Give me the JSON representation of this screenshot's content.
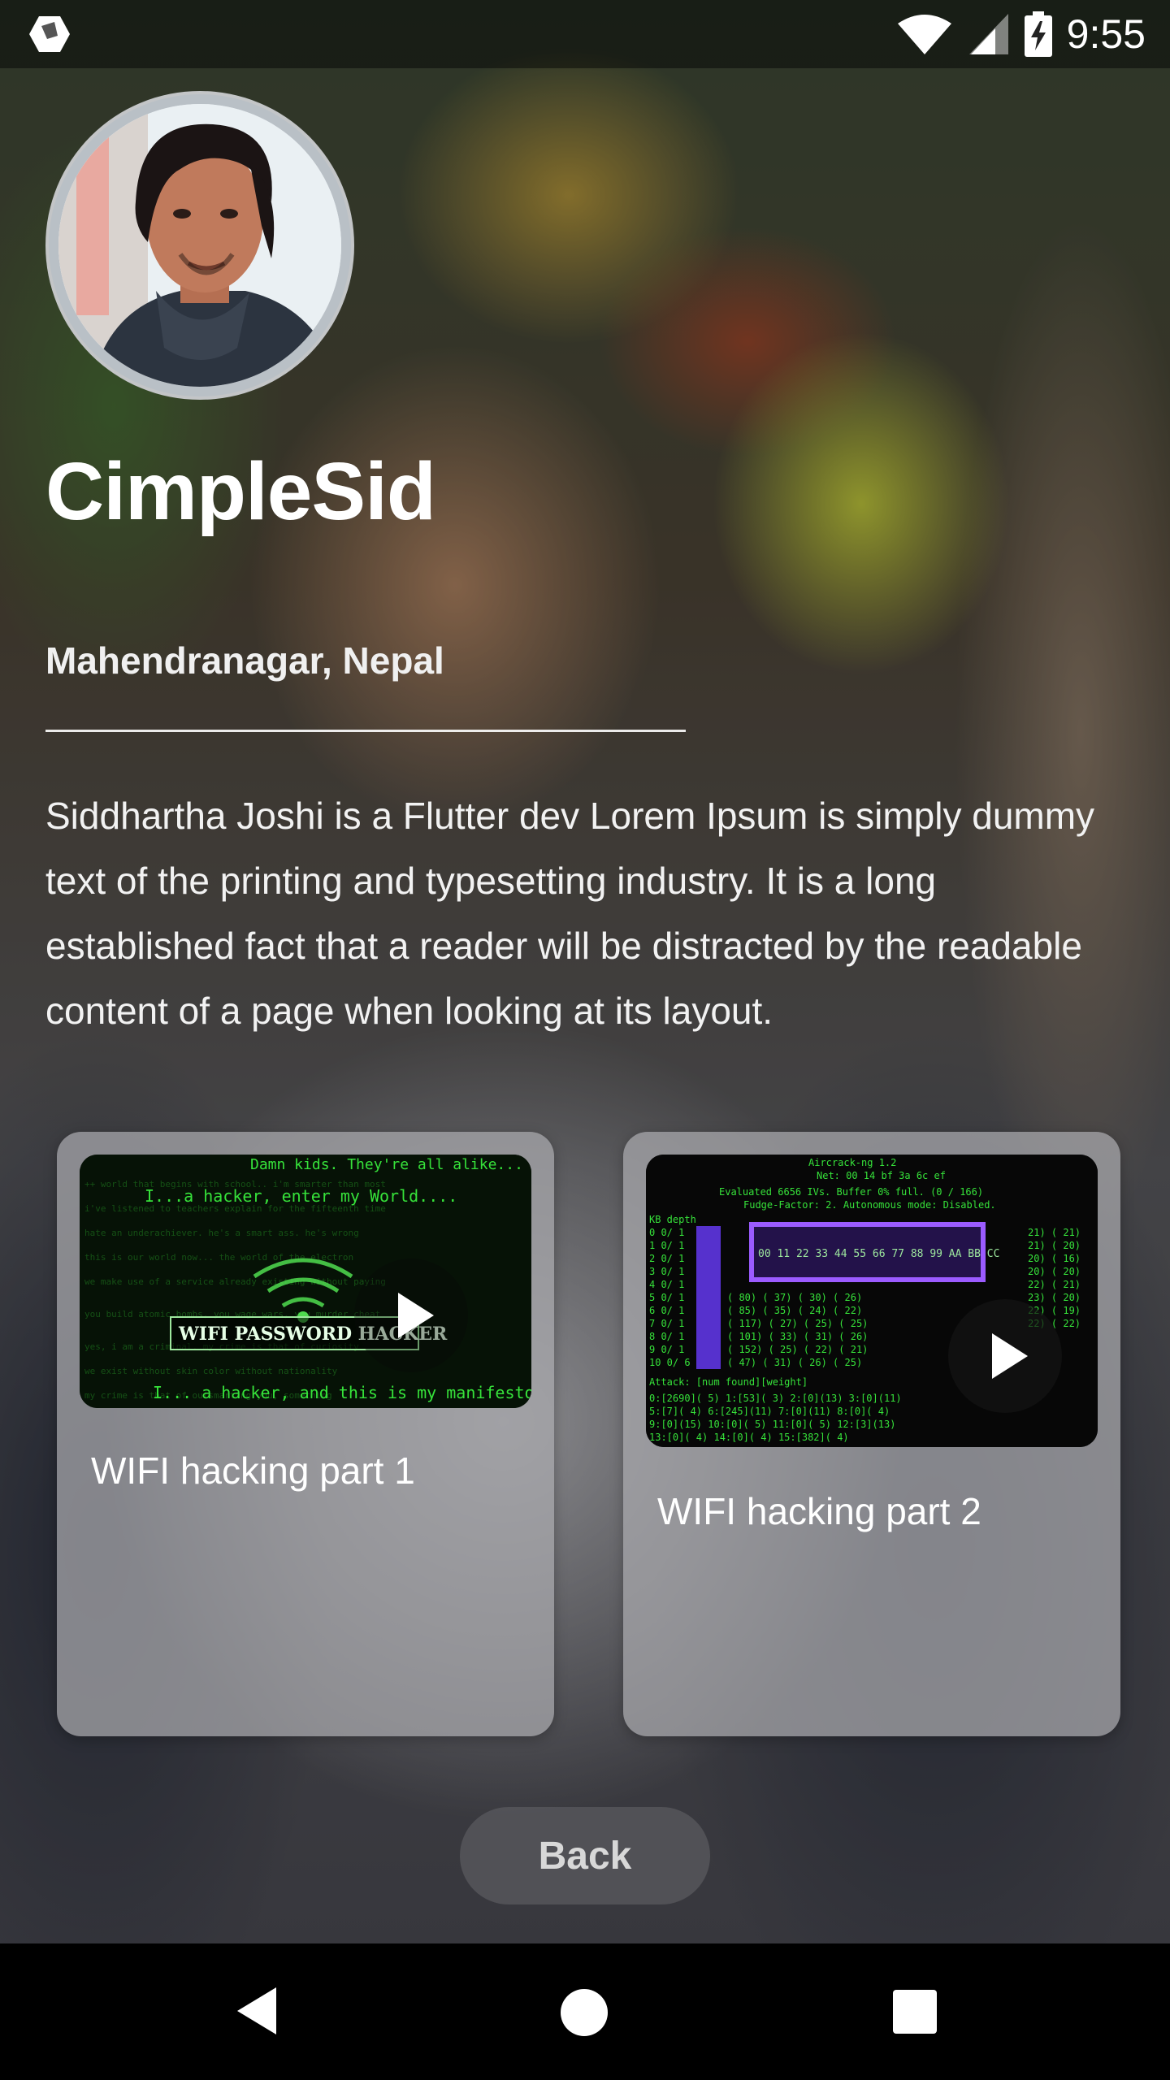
{
  "status_bar": {
    "time": "9:55",
    "icons": [
      "app-icon",
      "wifi-icon",
      "signal-icon",
      "battery-charging-icon"
    ]
  },
  "profile": {
    "name": "CimpleSid",
    "location": "Mahendranagar, Nepal",
    "bio": "Siddhartha  Joshi is a Flutter dev  Lorem Ipsum is simply dummy text of the printing and typesetting industry.  It is a long established fact that a reader will be distracted by the readable content of a page when looking at its layout."
  },
  "videos": [
    {
      "title": "WIFI hacking part 1",
      "thumb_text_top": "Damn kids. They're all alike...",
      "thumb_text_mid": "I...a hacker, enter my World....",
      "thumb_banner": "WIFI PASSWORD HACKER",
      "thumb_text_bottom": "I... a hacker, and this is my manifesto."
    },
    {
      "title": "WIFI hacking part 2",
      "thumb_text_top": "Aircrack-ng 1.2",
      "thumb_text_mid": "Evaluated 6656 IVs. Buffer 0% full. (0 / 166)",
      "thumb_text_bottom": "Attack: [num found][weight]"
    }
  ],
  "actions": {
    "back_label": "Back"
  },
  "colors": {
    "hacker_green": "#36e23a",
    "terminal_purple": "#8a3cff"
  }
}
